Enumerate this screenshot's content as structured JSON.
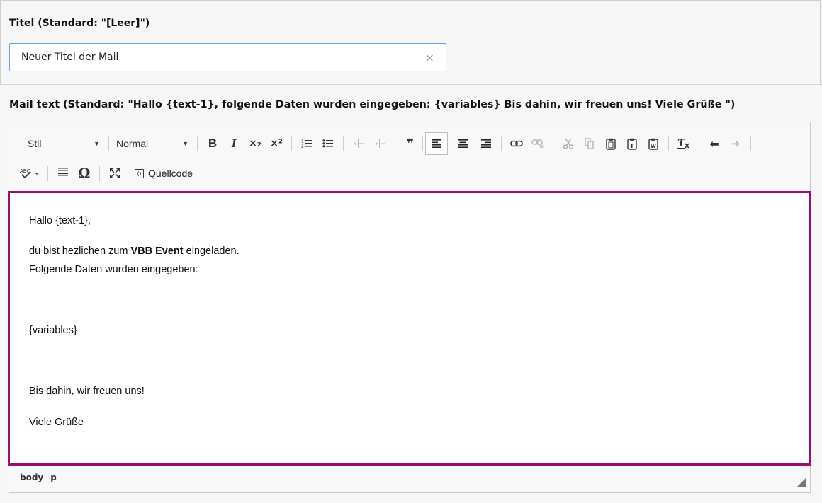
{
  "title_field": {
    "label": "Titel (Standard: \"[Leer]\")",
    "value": "Neuer Titel der Mail",
    "clear_symbol": "×"
  },
  "mail_field": {
    "label": "Mail text (Standard: \"Hallo {text-1}, folgende Daten wurden eingegeben: {variables} Bis dahin, wir freuen uns! Viele Grüße \")"
  },
  "toolbar": {
    "style_combo": "Stil",
    "format_combo": "Normal",
    "source_label": "Quellcode",
    "icons": [
      "bold-icon",
      "italic-icon",
      "subscript-icon",
      "superscript-icon",
      "numbered-list-icon",
      "bulleted-list-icon",
      "decrease-indent-icon",
      "increase-indent-icon",
      "blockquote-icon",
      "align-left-icon",
      "align-center-icon",
      "align-right-icon",
      "link-icon",
      "unlink-icon",
      "cut-icon",
      "copy-icon",
      "paste-icon",
      "paste-text-icon",
      "paste-word-icon",
      "remove-format-icon",
      "undo-icon",
      "redo-icon",
      "spellcheck-icon",
      "horizontal-rule-icon",
      "special-char-icon",
      "maximize-icon",
      "source-icon"
    ],
    "glyphs": {
      "bold": "B",
      "italic": "I",
      "subscript": "×₂",
      "superscript": "×²",
      "blockquote": "❞",
      "undo": "⬅",
      "redo": "➜",
      "omega": "Ω"
    }
  },
  "content": {
    "line1": "Hallo {text-1},",
    "line2_prefix": "du bist hezlichen zum ",
    "line2_bold": "VBB Event",
    "line2_suffix": " eingeladen.",
    "line3": "Folgende Daten wurden eingegeben:",
    "line4": "{variables}",
    "line5": "Bis dahin, wir freuen uns!",
    "line6": "Viele Grüße"
  },
  "footer": {
    "path": [
      "body",
      "p"
    ]
  },
  "colors": {
    "focus_border": "#9a0f6c",
    "input_border": "#6aa2de"
  }
}
